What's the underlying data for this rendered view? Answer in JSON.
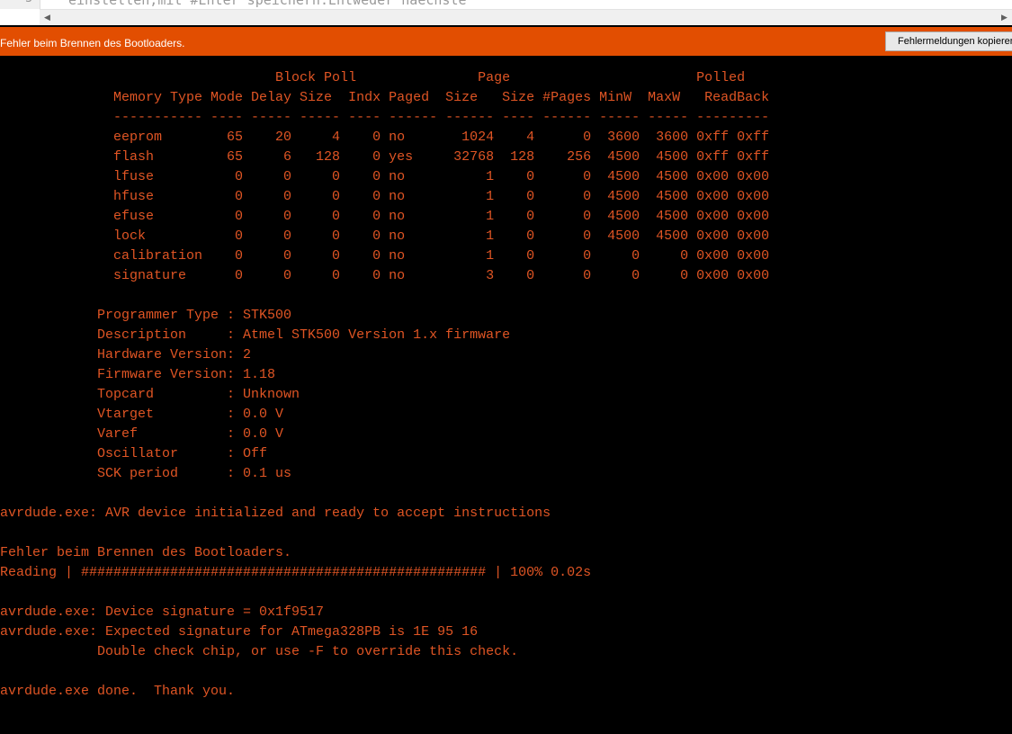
{
  "editor": {
    "line_number": "3",
    "code_text": "einstellen,mit #Enter speichern.Entweder naechste"
  },
  "status_bar": {
    "message": "Fehler beim Brennen des Bootloaders.",
    "copy_button_label": "Fehlermeldungen kopieren",
    "background_color": "#e24e01"
  },
  "console": {
    "text_color": "#e05524",
    "lines": [
      "                                  Block Poll               Page                       Polled",
      "              Memory Type Mode Delay Size  Indx Paged  Size   Size #Pages MinW  MaxW   ReadBack",
      "              ----------- ---- ----- ----- ---- ------ ------ ---- ------ ----- ----- ---------",
      "              eeprom        65    20     4    0 no       1024    4      0  3600  3600 0xff 0xff",
      "              flash         65     6   128    0 yes     32768  128    256  4500  4500 0xff 0xff",
      "              lfuse          0     0     0    0 no          1    0      0  4500  4500 0x00 0x00",
      "              hfuse          0     0     0    0 no          1    0      0  4500  4500 0x00 0x00",
      "              efuse          0     0     0    0 no          1    0      0  4500  4500 0x00 0x00",
      "              lock           0     0     0    0 no          1    0      0  4500  4500 0x00 0x00",
      "              calibration    0     0     0    0 no          1    0      0     0     0 0x00 0x00",
      "              signature      0     0     0    0 no          3    0      0     0     0 0x00 0x00",
      "",
      "            Programmer Type : STK500",
      "            Description     : Atmel STK500 Version 1.x firmware",
      "            Hardware Version: 2",
      "            Firmware Version: 1.18",
      "            Topcard         : Unknown",
      "            Vtarget         : 0.0 V",
      "            Varef           : 0.0 V",
      "            Oscillator      : Off",
      "            SCK period      : 0.1 us",
      "",
      "avrdude.exe: AVR device initialized and ready to accept instructions",
      "",
      "Fehler beim Brennen des Bootloaders.",
      "Reading | ################################################## | 100% 0.02s",
      "",
      "avrdude.exe: Device signature = 0x1f9517",
      "avrdude.exe: Expected signature for ATmega328PB is 1E 95 16",
      "            Double check chip, or use -F to override this check.",
      "",
      "avrdude.exe done.  Thank you.",
      ""
    ]
  }
}
